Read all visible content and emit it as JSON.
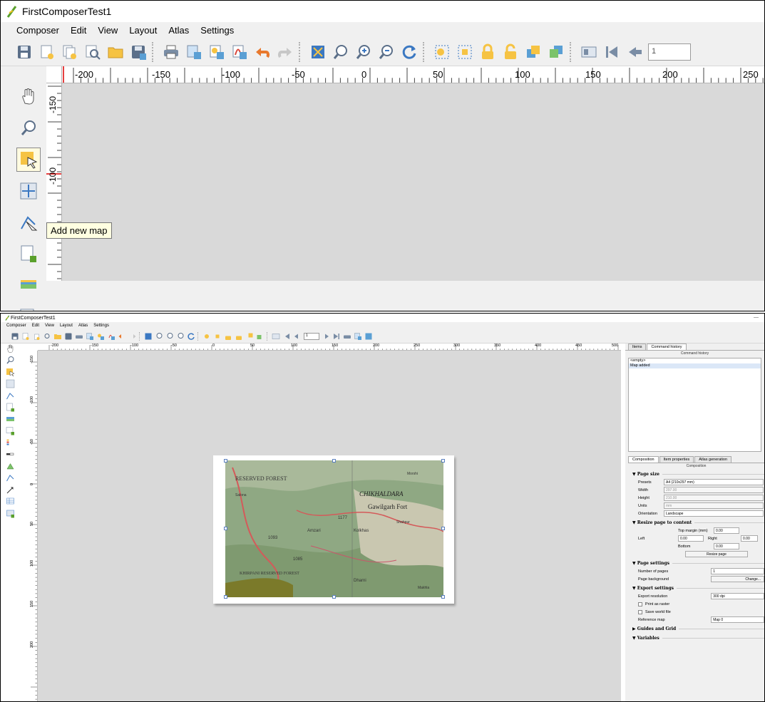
{
  "window": {
    "title": "FirstComposerTest1"
  },
  "menu": [
    "Composer",
    "Edit",
    "View",
    "Layout",
    "Atlas",
    "Settings"
  ],
  "toolbar": {
    "page_value": "1"
  },
  "tooltip": {
    "text": "Add new map"
  },
  "top_ruler": {
    "h_labels": [
      "-200",
      "-150",
      "-100",
      "-50",
      "0",
      "50",
      "100",
      "150",
      "200",
      "250"
    ],
    "v_labels": [
      "-150",
      "-100"
    ]
  },
  "bottom_ruler": {
    "h_labels": [
      "-200",
      "-150",
      "-100",
      "-50",
      "0",
      "50",
      "100",
      "150",
      "200",
      "250",
      "300",
      "350",
      "400",
      "450",
      "500"
    ],
    "v_labels": [
      "-150",
      "-100",
      "-50",
      "0",
      "50",
      "100",
      "150",
      "200"
    ]
  },
  "panel": {
    "top_tabs": [
      "Items",
      "Command history"
    ],
    "top_header": "Command history",
    "history": [
      "<empty>",
      "Map added"
    ],
    "bottom_tabs": [
      "Composition",
      "Item properties",
      "Atlas generation"
    ],
    "bottom_header": "Composition",
    "page_size": {
      "title": "Page size",
      "presets_label": "Presets",
      "presets_value": "A4 (210x297 mm)",
      "width_label": "Width",
      "width_value": "297.00",
      "height_label": "Height",
      "height_value": "210.00",
      "units_label": "Units",
      "units_value": "mm",
      "orientation_label": "Orientation",
      "orientation_value": "Landscape"
    },
    "resize": {
      "title": "Resize page to content",
      "top_margin_label": "Top margin (mm)",
      "top_margin_value": "0.00",
      "left_label": "Left",
      "left_value": "0.00",
      "right_label": "Right",
      "right_value": "0.00",
      "bottom_label": "Bottom",
      "bottom_value": "0.00",
      "button": "Resize page"
    },
    "page_settings": {
      "title": "Page settings",
      "num_pages_label": "Number of pages",
      "num_pages_value": "1",
      "bg_label": "Page background",
      "bg_button": "Change..."
    },
    "export": {
      "title": "Export settings",
      "res_label": "Export resolution",
      "res_value": "300 dpi",
      "raster_label": "Print as raster",
      "world_label": "Save world file",
      "ref_label": "Reference map",
      "ref_value": "Map 0"
    },
    "guides": {
      "title": "Guides and Grid"
    },
    "variables": {
      "title": "Variables"
    }
  },
  "map": {
    "labels": [
      "RESERVED FOREST",
      "CHIKHALDARA",
      "Gawilgarh Fort",
      "Amzari",
      "Kolkhas",
      "Dharni",
      "1177",
      "1085",
      "1093",
      "KHIRPANI RESERVED FOREST",
      "Salona",
      "Shahpur",
      "Morshi",
      "Makhla"
    ]
  },
  "colors": {
    "canvas": "#d9d9d9",
    "selection_handle": "#5a7fbf",
    "tool_yellow": "#f6c343"
  }
}
